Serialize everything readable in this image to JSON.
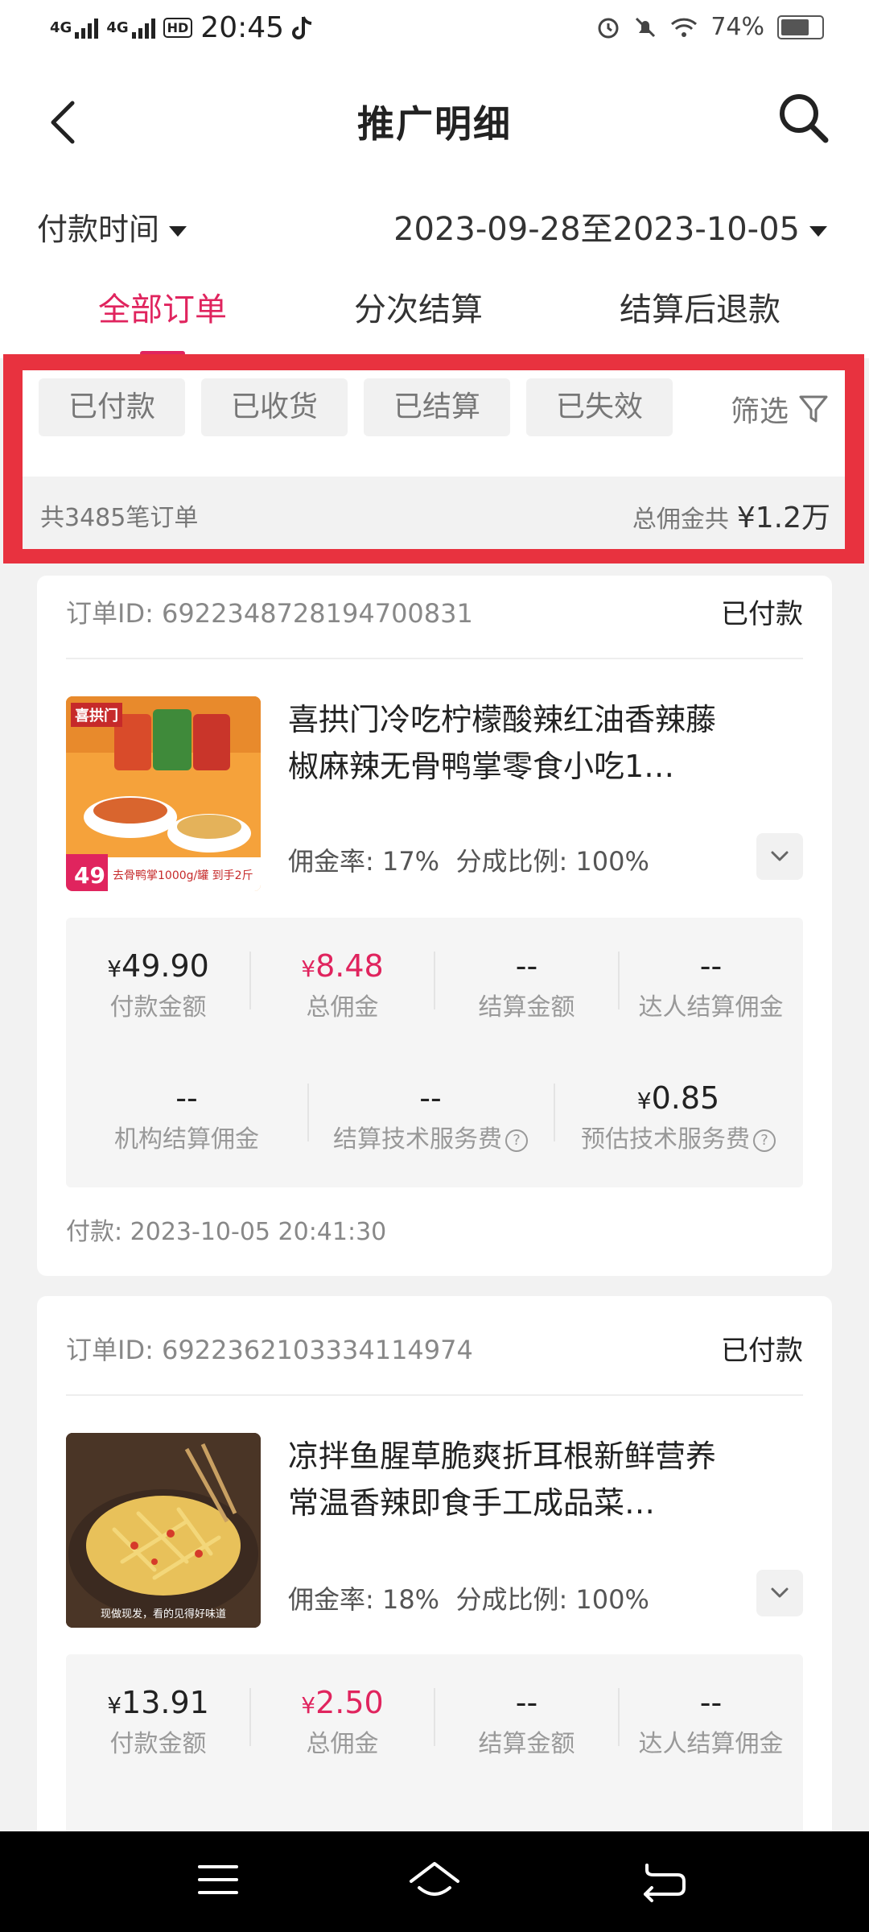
{
  "status_bar": {
    "signal1": "4G",
    "signal2": "4G",
    "hd": "HD",
    "time": "20:45",
    "battery": "74%"
  },
  "header": {
    "title": "推广明细"
  },
  "date_filter": {
    "label": "付款时间",
    "range": "2023-09-28至2023-10-05"
  },
  "tabs": [
    {
      "label": "全部订单",
      "active": true
    },
    {
      "label": "分次结算",
      "active": false
    },
    {
      "label": "结算后退款",
      "active": false
    }
  ],
  "status_chips": [
    "已付款",
    "已收货",
    "已结算",
    "已失效"
  ],
  "filter_label": "筛选",
  "summary": {
    "count_text": "共3485笔订单",
    "commission_label": "总佣金共",
    "commission_value": "¥1.2万"
  },
  "orders": [
    {
      "order_id": "订单ID: 6922348728194700831",
      "status": "已付款",
      "product_name": "喜拱门冷吃柠檬酸辣红油香辣藤椒麻辣无骨鸭掌零食小吃1…",
      "thumb_brand": "喜拱门",
      "thumb_price": "49",
      "thumb_banner": "去骨鸭掌1000g/罐 到手2斤",
      "rate_text": "佣金率: 17%",
      "split_text": "分成比例: 100%",
      "metrics_row1": [
        {
          "value": "49.90",
          "yen": true,
          "label": "付款金额",
          "pink": false
        },
        {
          "value": "8.48",
          "yen": true,
          "label": "总佣金",
          "pink": true
        },
        {
          "value": "--",
          "yen": false,
          "label": "结算金额",
          "pink": false
        },
        {
          "value": "--",
          "yen": false,
          "label": "达人结算佣金",
          "pink": false
        }
      ],
      "metrics_row2": [
        {
          "value": "--",
          "yen": false,
          "label": "机构结算佣金"
        },
        {
          "value": "--",
          "yen": false,
          "label": "结算技术服务费"
        },
        {
          "value": "0.85",
          "yen": true,
          "label": "预估技术服务费"
        }
      ],
      "pay_time": "付款: 2023-10-05 20:41:30"
    },
    {
      "order_id": "订单ID: 6922362103334114974",
      "status": "已付款",
      "product_name": "凉拌鱼腥草脆爽折耳根新鲜营养常温香辣即食手工成品菜…",
      "thumb_caption": "现做现发，看的见得好味道",
      "rate_text": "佣金率: 18%",
      "split_text": "分成比例: 100%",
      "metrics_row1": [
        {
          "value": "13.91",
          "yen": true,
          "label": "付款金额",
          "pink": false
        },
        {
          "value": "2.50",
          "yen": true,
          "label": "总佣金",
          "pink": true
        },
        {
          "value": "--",
          "yen": false,
          "label": "结算金额",
          "pink": false
        },
        {
          "value": "--",
          "yen": false,
          "label": "达人结算佣金",
          "pink": false
        }
      ]
    }
  ],
  "colors": {
    "accent": "#e0245e",
    "highlight_box": "#e8323f"
  }
}
